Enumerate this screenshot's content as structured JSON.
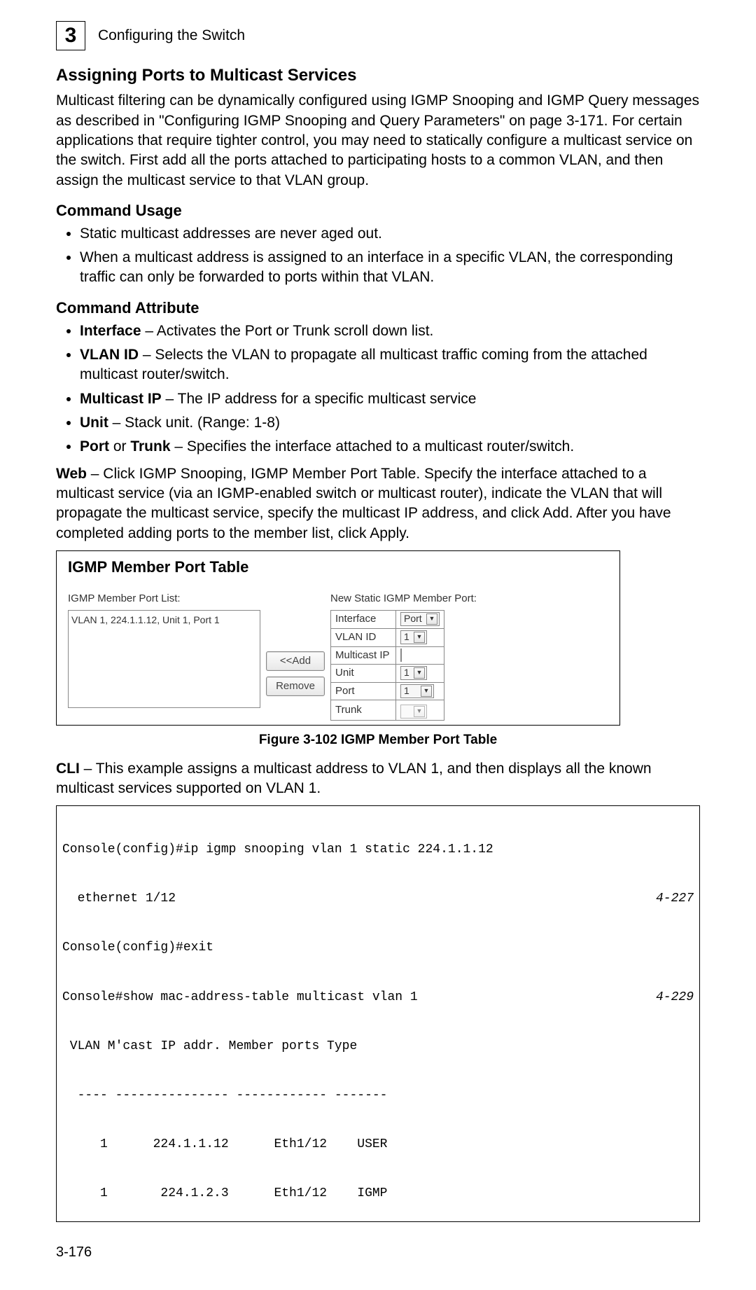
{
  "header": {
    "chapter_number": "3",
    "chapter_title": "Configuring the Switch"
  },
  "section": {
    "title": "Assigning Ports to Multicast Services",
    "intro": "Multicast filtering can be dynamically configured using IGMP Snooping and IGMP Query messages as described in \"Configuring IGMP Snooping and Query Parameters\" on page 3-171. For certain applications that require tighter control, you may need to statically configure a multicast service on the switch. First add all the ports attached to participating hosts to a common VLAN, and then assign the multicast service to that VLAN group."
  },
  "cmd_usage": {
    "title": "Command Usage",
    "items": [
      "Static multicast addresses are never aged out.",
      "When a multicast address is assigned to an interface in a specific VLAN, the corresponding traffic can only be forwarded to ports within that VLAN."
    ]
  },
  "cmd_attr": {
    "title": "Command Attribute",
    "items": [
      {
        "term": "Interface",
        "desc": " – Activates the Port or Trunk scroll down list."
      },
      {
        "term": "VLAN ID",
        "desc": " – Selects the VLAN to propagate all multicast traffic coming from the attached multicast router/switch."
      },
      {
        "term": "Multicast IP",
        "desc": " – The IP address for a specific multicast service"
      },
      {
        "term": "Unit",
        "desc": " – Stack unit. (Range: 1-8)"
      },
      {
        "term": "Port",
        "term2": "Trunk",
        "desc": " – Specifies the interface attached to a multicast router/switch."
      }
    ]
  },
  "web_note": {
    "prefix": "Web",
    "text": " – Click IGMP Snooping, IGMP Member Port Table. Specify the interface attached to a multicast service (via an IGMP-enabled switch or multicast router), indicate the VLAN that will propagate the multicast service, specify the multicast IP address, and click Add. After you have completed adding ports to the member list, click Apply."
  },
  "figure": {
    "panel_title": "IGMP Member Port Table",
    "list_label": "IGMP Member Port List:",
    "list_entry": "VLAN 1, 224.1.1.12, Unit 1, Port 1",
    "new_label": "New Static IGMP Member Port:",
    "fields": {
      "interface_label": "Interface",
      "interface_value": "Port",
      "vlan_label": "VLAN ID",
      "vlan_value": "1",
      "mcastip_label": "Multicast IP",
      "unit_label": "Unit",
      "unit_value": "1",
      "port_label": "Port",
      "port_value": "1",
      "trunk_label": "Trunk"
    },
    "buttons": {
      "add": "<<Add",
      "remove": "Remove"
    },
    "caption": "Figure 3-102   IGMP Member Port Table"
  },
  "cli": {
    "prefix": "CLI",
    "intro": " – This example assigns a multicast address to VLAN 1, and then displays all the known multicast services supported on VLAN 1.",
    "lines": [
      {
        "l": "Console(config)#ip igmp snooping vlan 1 static 224.1.1.12",
        "r": ""
      },
      {
        "l": "  ethernet 1/12",
        "r": "4-227"
      },
      {
        "l": "Console(config)#exit",
        "r": ""
      },
      {
        "l": "Console#show mac-address-table multicast vlan 1",
        "r": "4-229"
      },
      {
        "l": " VLAN M'cast IP addr. Member ports Type",
        "r": ""
      },
      {
        "l": "  ---- --------------- ------------ -------",
        "r": ""
      },
      {
        "l": "     1      224.1.1.12      Eth1/12    USER",
        "r": ""
      },
      {
        "l": "     1       224.1.2.3      Eth1/12    IGMP",
        "r": ""
      }
    ]
  },
  "page_number": "3-176"
}
